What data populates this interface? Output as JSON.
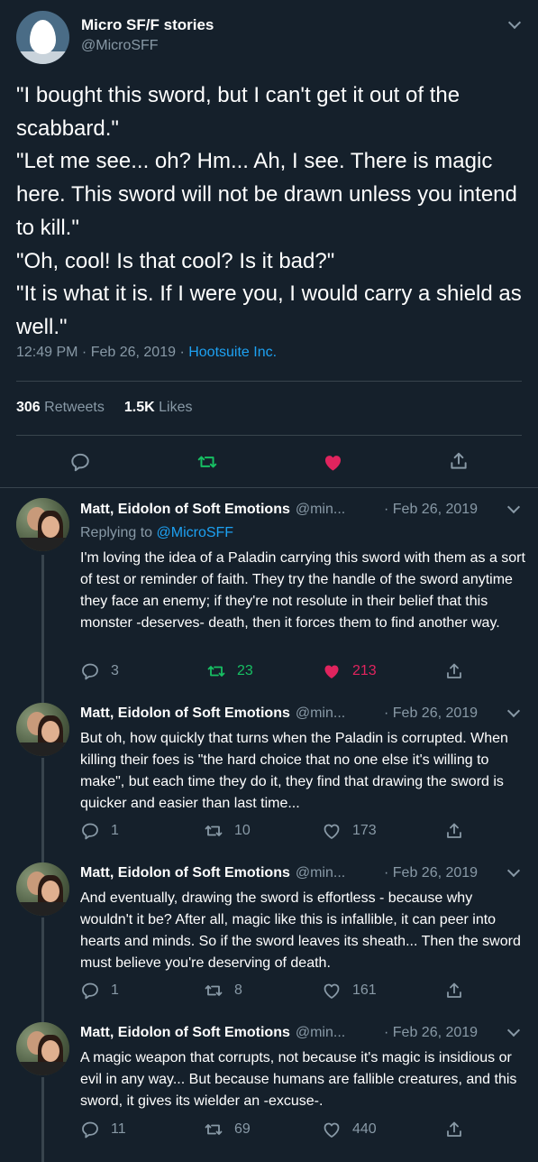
{
  "main_tweet": {
    "display_name": "Micro SF/F stories",
    "handle": "@MicroSFF",
    "lines": [
      "\"I bought this sword, but I can't get it out of the scabbard.\"",
      "\"Let me see... oh? Hm... Ah, I see. There is magic here. This sword will not be drawn unless you intend to kill.\"",
      "\"Oh, cool! Is that cool? Is it bad?\"",
      "\"It is what it is. If I were you, I would carry a shield as well.\""
    ],
    "time": "12:49 PM · Feb 26, 2019 · ",
    "source": "Hootsuite Inc.",
    "retweets_count": "306",
    "retweets_label": "Retweets",
    "likes_count": "1.5K",
    "likes_label": "Likes",
    "icons": [
      "reply-icon",
      "retweet-icon",
      "like-icon",
      "share-icon"
    ],
    "colors": {
      "retweet": "#17bf63",
      "like": "#e0245e"
    }
  },
  "replies": [
    {
      "display_name": "Matt, Eidolon of Soft Emotions",
      "handle": "@min...",
      "date": "· Feb 26, 2019",
      "replying_to_prefix": "Replying to ",
      "replying_to": "@MicroSFF",
      "text": "I'm loving the idea of a Paladin carrying this sword with them as a sort of test or reminder of faith. They try the handle of the sword anytime they face an enemy; if they're not resolute in their belief that this monster -deserves- death, then it forces them to find another way.",
      "replies": "3",
      "retweets": "23",
      "likes": "213",
      "retweeted": true,
      "liked": true
    },
    {
      "display_name": "Matt, Eidolon of Soft Emotions",
      "handle": "@min...",
      "date": "· Feb 26, 2019",
      "text": "But oh, how quickly that turns when the Paladin is corrupted. When killing their foes is \"the hard choice that no one else it's willing to make\", but each time they do it, they find that drawing the sword is quicker and easier than last time...",
      "replies": "1",
      "retweets": "10",
      "likes": "173",
      "retweeted": false,
      "liked": false
    },
    {
      "display_name": "Matt, Eidolon of Soft Emotions",
      "handle": "@min...",
      "date": "· Feb 26, 2019",
      "text": "And eventually, drawing the sword is effortless - because why wouldn't it be? After all, magic like this is infallible, it can peer into hearts and minds. So if the sword leaves its sheath... Then the sword must believe you're deserving of death.",
      "replies": "1",
      "retweets": "8",
      "likes": "161",
      "retweeted": false,
      "liked": false
    },
    {
      "display_name": "Matt, Eidolon of Soft Emotions",
      "handle": "@min...",
      "date": "· Feb 26, 2019",
      "text": "A magic weapon that corrupts, not because it's magic is insidious or evil in any way... But because humans are fallible creatures, and this sword, it gives its wielder an -excuse-.",
      "replies": "11",
      "retweets": "69",
      "likes": "440",
      "retweeted": false,
      "liked": false
    }
  ]
}
